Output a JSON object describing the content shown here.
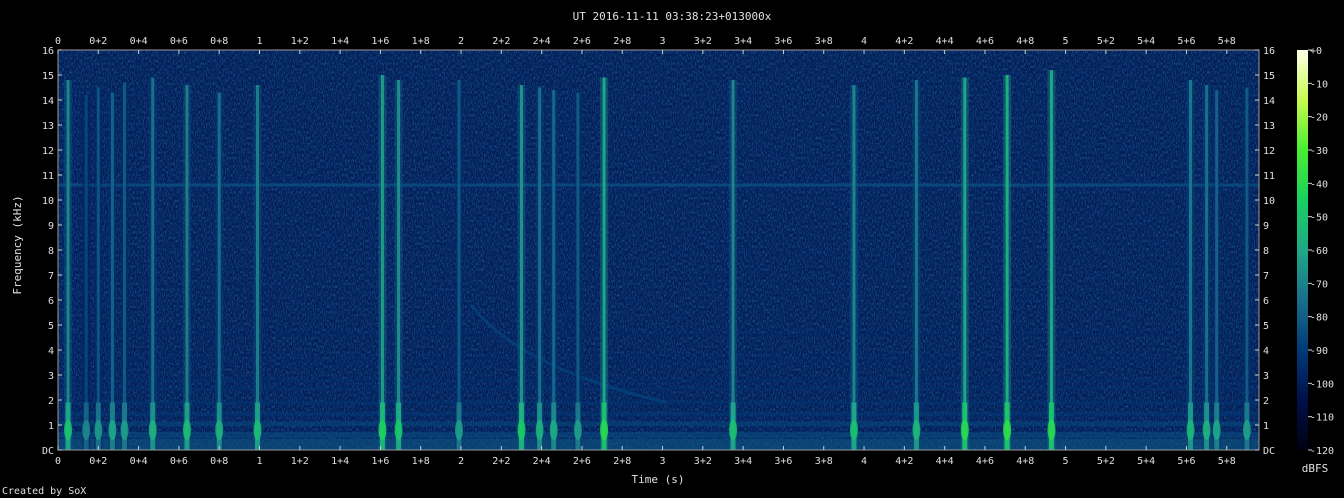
{
  "chart_data": {
    "type": "heatmap",
    "title": "UT 2016-11-11 03:38:23+013000x",
    "xlabel": "Time (s)",
    "ylabel": "Frequency (kHz)",
    "xlim": [
      0,
      5.96
    ],
    "ylim": [
      0,
      16
    ],
    "x_ticks": [
      "0",
      "0+2",
      "0+4",
      "0+6",
      "0+8",
      "1",
      "1+2",
      "1+4",
      "1+6",
      "1+8",
      "2",
      "2+2",
      "2+4",
      "2+6",
      "2+8",
      "3",
      "3+2",
      "3+4",
      "3+6",
      "3+8",
      "4",
      "4+2",
      "4+4",
      "4+6",
      "4+8",
      "5",
      "5+2",
      "5+4",
      "5+6",
      "5+8"
    ],
    "x_tick_values": [
      0,
      0.2,
      0.4,
      0.6,
      0.8,
      1,
      1.2,
      1.4,
      1.6,
      1.8,
      2,
      2.2,
      2.4,
      2.6,
      2.8,
      3,
      3.2,
      3.4,
      3.6,
      3.8,
      4,
      4.2,
      4.4,
      4.6,
      4.8,
      5,
      5.2,
      5.4,
      5.6,
      5.8
    ],
    "y_ticks": [
      "DC",
      "1",
      "2",
      "3",
      "4",
      "5",
      "6",
      "7",
      "8",
      "9",
      "10",
      "11",
      "12",
      "13",
      "14",
      "15",
      "16"
    ],
    "y_tick_values": [
      0,
      1,
      2,
      3,
      4,
      5,
      6,
      7,
      8,
      9,
      10,
      11,
      12,
      13,
      14,
      15,
      16
    ],
    "colorbar": {
      "label": "dBFS",
      "range": [
        -120,
        0
      ],
      "ticks": [
        "+0",
        "-10",
        "-20",
        "-30",
        "-40",
        "-50",
        "-60",
        "-70",
        "-80",
        "-90",
        "-100",
        "-110",
        "-120"
      ],
      "tick_values": [
        0,
        -10,
        -20,
        -30,
        -40,
        -50,
        -60,
        -70,
        -80,
        -90,
        -100,
        -110,
        -120
      ],
      "stops": [
        "#000010",
        "#00104a",
        "#003a78",
        "#1a6e8a",
        "#1fa888",
        "#18d060",
        "#48ee30",
        "#c8fa50",
        "#ffffe8"
      ]
    },
    "background_level_dbfs": -100,
    "persistent_tone": {
      "freq_khz": 10.6,
      "level_dbfs": -85
    },
    "sweep": {
      "t_start": 2.05,
      "f_start_khz": 5.8,
      "t_end": 3.02,
      "f_end_khz": 1.9,
      "level_dbfs": -88
    },
    "events": [
      {
        "t": 0.05,
        "f_top_khz": 14.8,
        "level_dbfs": -60
      },
      {
        "t": 0.14,
        "f_top_khz": 14.2,
        "level_dbfs": -78
      },
      {
        "t": 0.2,
        "f_top_khz": 14.5,
        "level_dbfs": -74
      },
      {
        "t": 0.27,
        "f_top_khz": 14.3,
        "level_dbfs": -70
      },
      {
        "t": 0.33,
        "f_top_khz": 14.7,
        "level_dbfs": -72
      },
      {
        "t": 0.47,
        "f_top_khz": 14.9,
        "level_dbfs": -66
      },
      {
        "t": 0.64,
        "f_top_khz": 14.6,
        "level_dbfs": -62
      },
      {
        "t": 0.8,
        "f_top_khz": 14.3,
        "level_dbfs": -66
      },
      {
        "t": 0.99,
        "f_top_khz": 14.6,
        "level_dbfs": -62
      },
      {
        "t": 1.61,
        "f_top_khz": 15.0,
        "level_dbfs": -54
      },
      {
        "t": 1.69,
        "f_top_khz": 14.8,
        "level_dbfs": -58
      },
      {
        "t": 1.99,
        "f_top_khz": 14.8,
        "level_dbfs": -72
      },
      {
        "t": 2.3,
        "f_top_khz": 14.6,
        "level_dbfs": -56
      },
      {
        "t": 2.39,
        "f_top_khz": 14.5,
        "level_dbfs": -66
      },
      {
        "t": 2.46,
        "f_top_khz": 14.4,
        "level_dbfs": -68
      },
      {
        "t": 2.58,
        "f_top_khz": 14.3,
        "level_dbfs": -72
      },
      {
        "t": 2.71,
        "f_top_khz": 14.9,
        "level_dbfs": -50
      },
      {
        "t": 3.35,
        "f_top_khz": 14.8,
        "level_dbfs": -60
      },
      {
        "t": 3.95,
        "f_top_khz": 14.6,
        "level_dbfs": -60
      },
      {
        "t": 4.26,
        "f_top_khz": 14.8,
        "level_dbfs": -64
      },
      {
        "t": 4.5,
        "f_top_khz": 14.9,
        "level_dbfs": -50
      },
      {
        "t": 4.71,
        "f_top_khz": 15.0,
        "level_dbfs": -48
      },
      {
        "t": 4.93,
        "f_top_khz": 15.2,
        "level_dbfs": -50
      },
      {
        "t": 5.62,
        "f_top_khz": 14.8,
        "level_dbfs": -64
      },
      {
        "t": 5.7,
        "f_top_khz": 14.6,
        "level_dbfs": -66
      },
      {
        "t": 5.75,
        "f_top_khz": 14.4,
        "level_dbfs": -70
      },
      {
        "t": 5.9,
        "f_top_khz": 14.5,
        "level_dbfs": -72
      }
    ]
  },
  "footer": {
    "credit": "Created by SoX"
  }
}
